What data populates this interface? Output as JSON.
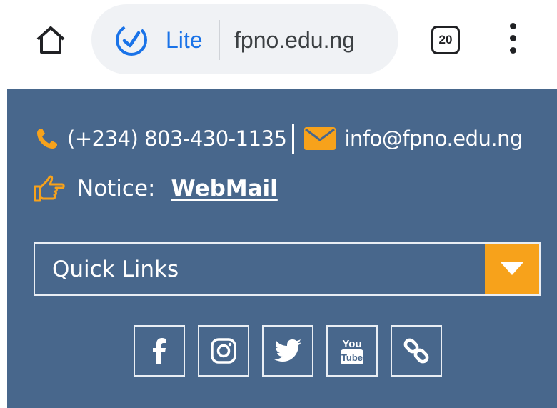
{
  "browser": {
    "lite_label": "Lite",
    "url": "fpno.edu.ng",
    "tab_count": "20",
    "icons": [
      "home-icon",
      "speedometer-icon",
      "tab-switcher-icon",
      "more-vert-icon"
    ]
  },
  "contact": {
    "phone": "(+234) 803-430-1135",
    "email": "info@fpno.edu.ng"
  },
  "notice": {
    "label": "Notice:",
    "link": "WebMail"
  },
  "quicklinks": {
    "selected": "Quick Links"
  },
  "social": [
    {
      "name": "facebook-icon"
    },
    {
      "name": "instagram-icon"
    },
    {
      "name": "twitter-icon"
    },
    {
      "name": "youtube-icon",
      "text_top": "You",
      "text_bottom": "Tube"
    },
    {
      "name": "link-icon"
    }
  ],
  "colors": {
    "panel": "#48678c",
    "accent": "#f7a21b",
    "chrome_blue": "#1a73e8",
    "omnibox": "#f0f2f5"
  }
}
